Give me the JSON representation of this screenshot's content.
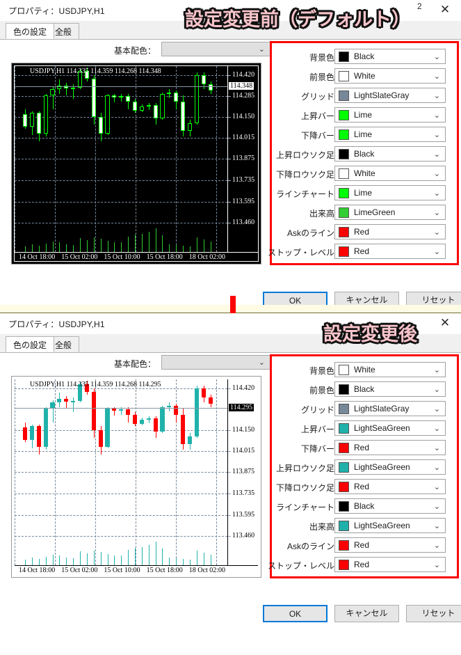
{
  "annotations": {
    "top_label": "設定変更前（デフォルト）",
    "top_superscript": "2",
    "bottom_label": "設定変更後"
  },
  "panels": [
    {
      "id": "before",
      "title": "プロパティ：USDJPY,H1",
      "close_icon": "✕",
      "tabs": [
        {
          "label": "色の設定",
          "active": true
        },
        {
          "label": "全般",
          "active": false
        }
      ],
      "scheme": {
        "label": "基本配色：",
        "value": "",
        "chevron": "⌄"
      },
      "settings": [
        {
          "label": "背景色：",
          "value": "Black",
          "color": "#000000"
        },
        {
          "label": "前景色：",
          "value": "White",
          "color": "#ffffff"
        },
        {
          "label": "グリッド：",
          "value": "LightSlateGray",
          "color": "#778899"
        },
        {
          "label": "上昇バー：",
          "value": "Lime",
          "color": "#00ff00"
        },
        {
          "label": "下降バー：",
          "value": "Lime",
          "color": "#00ff00"
        },
        {
          "label": "上昇ロウソク足：",
          "value": "Black",
          "color": "#000000"
        },
        {
          "label": "下降ロウソク足：",
          "value": "White",
          "color": "#ffffff"
        },
        {
          "label": "ラインチャート：",
          "value": "Lime",
          "color": "#00ff00"
        },
        {
          "label": "出来高：",
          "value": "LimeGreen",
          "color": "#32cd32"
        },
        {
          "label": "Askのライン：",
          "value": "Red",
          "color": "#ff0000"
        },
        {
          "label": "ストップ・レベル：",
          "value": "Red",
          "color": "#ff0000"
        }
      ],
      "buttons": [
        {
          "label": "OK",
          "primary": true
        },
        {
          "label": "キャンセル",
          "primary": false
        },
        {
          "label": "リセット",
          "primary": false
        }
      ]
    },
    {
      "id": "after",
      "title": "プロパティ：USDJPY,H1",
      "close_icon": "✕",
      "tabs": [
        {
          "label": "色の設定",
          "active": true
        },
        {
          "label": "全般",
          "active": false
        }
      ],
      "scheme": {
        "label": "基本配色：",
        "value": "",
        "chevron": "⌄"
      },
      "settings": [
        {
          "label": "背景色：",
          "value": "White",
          "color": "#ffffff"
        },
        {
          "label": "前景色：",
          "value": "Black",
          "color": "#000000"
        },
        {
          "label": "グリッド：",
          "value": "LightSlateGray",
          "color": "#778899"
        },
        {
          "label": "上昇バー：",
          "value": "LightSeaGreen",
          "color": "#20b2aa"
        },
        {
          "label": "下降バー：",
          "value": "Red",
          "color": "#ff0000"
        },
        {
          "label": "上昇ロウソク足：",
          "value": "LightSeaGreen",
          "color": "#20b2aa"
        },
        {
          "label": "下降ロウソク足：",
          "value": "Red",
          "color": "#ff0000"
        },
        {
          "label": "ラインチャート：",
          "value": "Black",
          "color": "#000000"
        },
        {
          "label": "出来高：",
          "value": "LightSeaGreen",
          "color": "#20b2aa"
        },
        {
          "label": "Askのライン：",
          "value": "Red",
          "color": "#ff0000"
        },
        {
          "label": "ストップ・レベル：",
          "value": "Red",
          "color": "#ff0000"
        }
      ],
      "buttons": [
        {
          "label": "OK",
          "primary": true
        },
        {
          "label": "キャンセル",
          "primary": false
        },
        {
          "label": "リセット",
          "primary": false
        }
      ]
    }
  ],
  "chart_data": [
    {
      "type": "candlestick",
      "id": "chart-before",
      "title": "USDJPY,H1",
      "ohlc_header": "USDJPY,H1  114.335 114.359 114.268 114.348",
      "open": 114.335,
      "high": 114.359,
      "low": 114.268,
      "close": 114.348,
      "current_price_label": "114.348",
      "theme": "dark",
      "background": "#000000",
      "foreground": "#ffffff",
      "grid_color": "#778899",
      "up_candle_color": "#000000",
      "down_candle_color": "#ffffff",
      "candle_outline_color": "#00ff00",
      "volume_color": "#32cd32",
      "price_ticks": [
        "114.420",
        "114.285",
        "114.150",
        "114.015",
        "113.875",
        "113.735",
        "113.595",
        "113.460"
      ],
      "ylim": [
        113.46,
        114.48
      ],
      "time_ticks": [
        "14 Oct 18:00",
        "15 Oct 02:00",
        "15 Oct 10:00",
        "15 Oct 18:00",
        "18 Oct 02:00"
      ],
      "xlabel": "",
      "ylabel": "",
      "grid": true,
      "legend": "none"
    },
    {
      "type": "candlestick",
      "id": "chart-after",
      "title": "USDJPY,H1",
      "ohlc_header": "USDJPY,H1  114.335 114.359 114.268 114.295",
      "open": 114.335,
      "high": 114.359,
      "low": 114.268,
      "close": 114.295,
      "current_price_label": "114.295",
      "theme": "light",
      "background": "#ffffff",
      "foreground": "#000000",
      "grid_color": "#778899",
      "up_candle_color": "#20b2aa",
      "down_candle_color": "#ff0000",
      "candle_outline_color": "#20b2aa",
      "volume_color": "#20b2aa",
      "price_ticks": [
        "114.420",
        "114.150",
        "114.015",
        "113.875",
        "113.735",
        "113.595",
        "113.460"
      ],
      "ylim": [
        113.46,
        114.48
      ],
      "time_ticks": [
        "14 Oct 18:00",
        "15 Oct 02:00",
        "15 Oct 10:00",
        "15 Oct 18:00",
        "18 Oct 02:00"
      ],
      "xlabel": "",
      "ylabel": "",
      "grid": true,
      "legend": "none"
    }
  ],
  "candles": [
    {
      "o": 114.165,
      "h": 114.2,
      "l": 114.07,
      "c": 114.085,
      "v": 0.22
    },
    {
      "o": 114.085,
      "h": 114.185,
      "l": 114.03,
      "c": 114.175,
      "v": 0.3
    },
    {
      "o": 114.175,
      "h": 114.185,
      "l": 113.99,
      "c": 114.04,
      "v": 0.25
    },
    {
      "o": 114.04,
      "h": 114.3,
      "l": 114.02,
      "c": 114.29,
      "v": 0.35
    },
    {
      "o": 114.29,
      "h": 114.345,
      "l": 114.2,
      "c": 114.33,
      "v": 0.42
    },
    {
      "o": 114.33,
      "h": 114.395,
      "l": 114.3,
      "c": 114.355,
      "v": 0.4
    },
    {
      "o": 114.355,
      "h": 114.37,
      "l": 114.29,
      "c": 114.335,
      "v": 0.3
    },
    {
      "o": 114.335,
      "h": 114.36,
      "l": 114.265,
      "c": 114.34,
      "v": 0.28
    },
    {
      "o": 114.34,
      "h": 114.46,
      "l": 114.33,
      "c": 114.45,
      "v": 0.55
    },
    {
      "o": 114.45,
      "h": 114.47,
      "l": 114.38,
      "c": 114.4,
      "v": 0.48
    },
    {
      "o": 114.4,
      "h": 114.42,
      "l": 114.1,
      "c": 114.15,
      "v": 0.6
    },
    {
      "o": 114.15,
      "h": 114.175,
      "l": 113.99,
      "c": 114.04,
      "v": 0.52
    },
    {
      "o": 114.04,
      "h": 114.3,
      "l": 114.03,
      "c": 114.29,
      "v": 0.45
    },
    {
      "o": 114.29,
      "h": 114.3,
      "l": 114.245,
      "c": 114.275,
      "v": 0.38
    },
    {
      "o": 114.275,
      "h": 114.3,
      "l": 114.25,
      "c": 114.285,
      "v": 0.4
    },
    {
      "o": 114.285,
      "h": 114.3,
      "l": 114.2,
      "c": 114.25,
      "v": 0.62
    },
    {
      "o": 114.25,
      "h": 114.265,
      "l": 114.175,
      "c": 114.19,
      "v": 0.7
    },
    {
      "o": 114.19,
      "h": 114.23,
      "l": 114.18,
      "c": 114.215,
      "v": 0.72
    },
    {
      "o": 114.215,
      "h": 114.24,
      "l": 114.195,
      "c": 114.225,
      "v": 0.8
    },
    {
      "o": 114.225,
      "h": 114.24,
      "l": 114.1,
      "c": 114.14,
      "v": 0.95
    },
    {
      "o": 114.14,
      "h": 114.31,
      "l": 114.13,
      "c": 114.3,
      "v": 0.68
    },
    {
      "o": 114.3,
      "h": 114.33,
      "l": 114.27,
      "c": 114.31,
      "v": 0.3
    },
    {
      "o": 114.31,
      "h": 114.32,
      "l": 114.2,
      "c": 114.25,
      "v": 0.28
    },
    {
      "o": 114.25,
      "h": 114.29,
      "l": 114.02,
      "c": 114.06,
      "v": 0.25
    },
    {
      "o": 114.06,
      "h": 114.13,
      "l": 114.02,
      "c": 114.11,
      "v": 0.22
    },
    {
      "o": 114.11,
      "h": 114.44,
      "l": 114.1,
      "c": 114.42,
      "v": 0.58
    },
    {
      "o": 114.42,
      "h": 114.44,
      "l": 114.33,
      "c": 114.36,
      "v": 0.5
    },
    {
      "o": 114.36,
      "h": 114.38,
      "l": 114.3,
      "c": 114.32,
      "v": 0.42
    }
  ]
}
